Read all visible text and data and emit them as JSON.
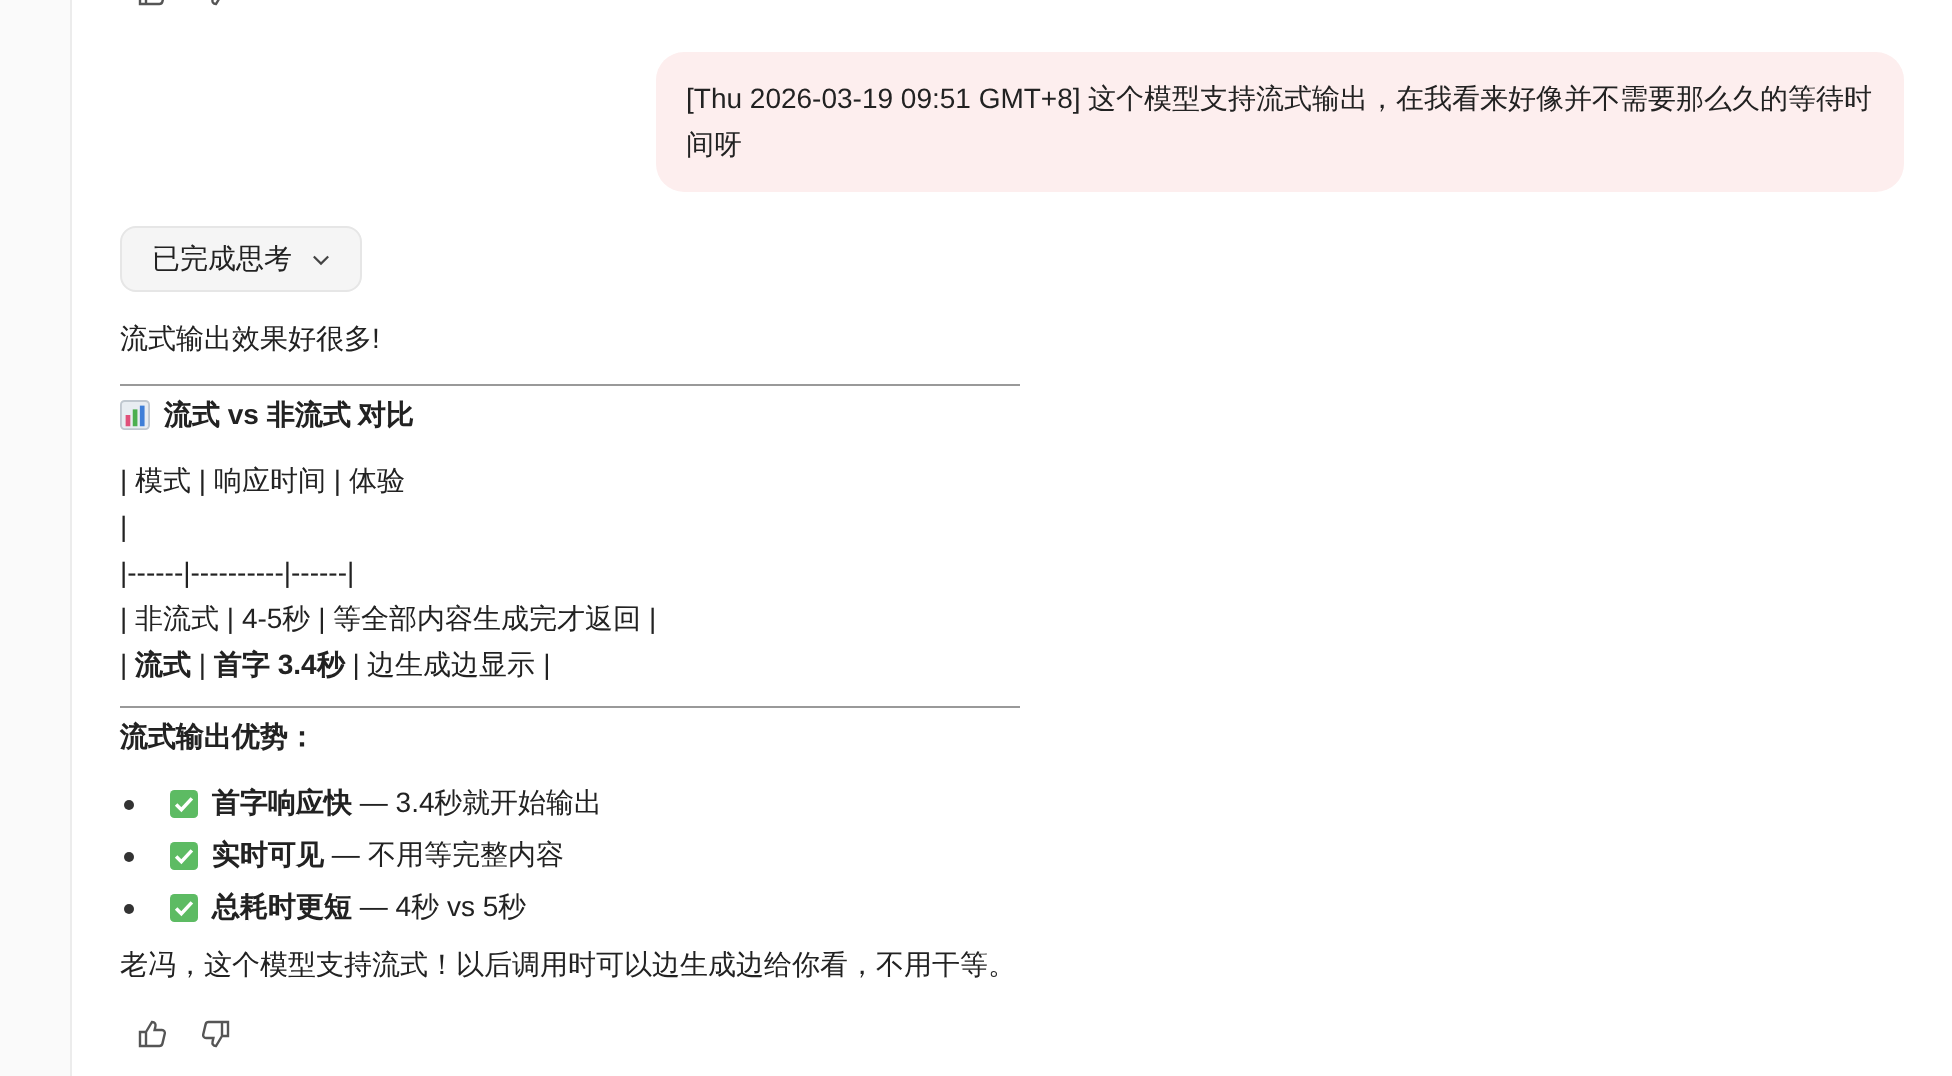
{
  "user_message": {
    "text": "[Thu 2026-03-19 09:51 GMT+8] 这个模型支持流式输出，在我看来好像并不需要那么久的等待时间呀"
  },
  "thinking_toggle": {
    "label": "已完成思考",
    "expanded": false
  },
  "reply": {
    "intro": "流式输出效果好很多!",
    "heading": "流式 vs 非流式 对比",
    "table_lines": [
      "| 模式 | 响应时间 | 体验",
      "|",
      "|------|----------|------|",
      "| 非流式 | 4-5秒 | 等全部内容生成完才返回 |",
      "| **流式** | **首字 3.4秒** | 边生成边显示 |"
    ],
    "advantages_heading": "流式输出优势：",
    "advantages": [
      {
        "text": "**首字响应快** — 3.4秒就开始输出"
      },
      {
        "text": "**实时可见** — 不用等完整内容"
      },
      {
        "text": "**总耗时更短** — 4秒 vs 5秒"
      }
    ],
    "closing": "老冯，这个模型支持流式！以后调用时可以边生成边给你看，不用干等。"
  }
}
